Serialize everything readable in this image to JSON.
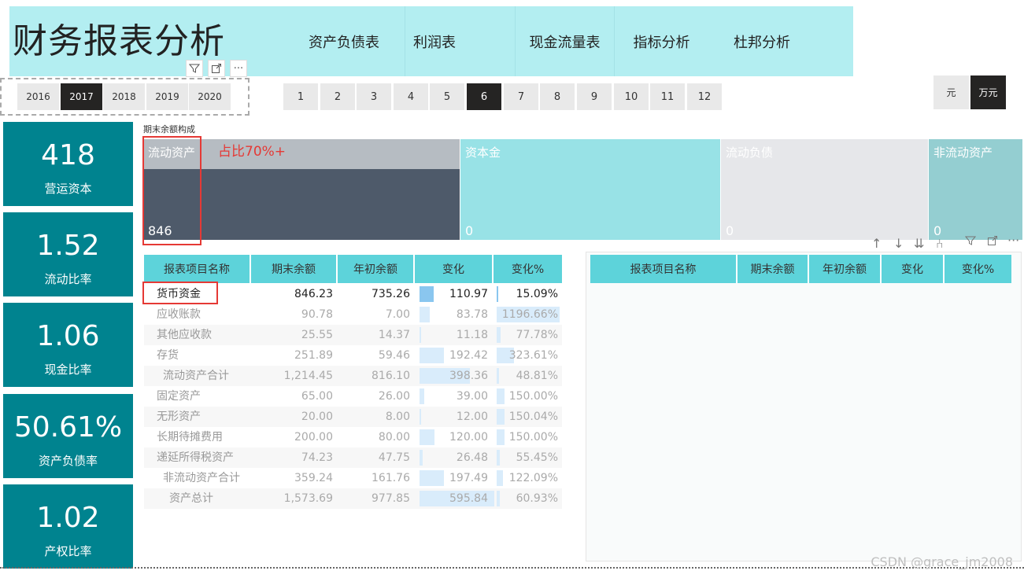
{
  "header": {
    "title": "财务报表分析",
    "nav": [
      "资产负债表",
      "利润表",
      "现金流量表",
      "指标分析",
      "杜邦分析"
    ]
  },
  "years": {
    "items": [
      "2016",
      "2017",
      "2018",
      "2019",
      "2020"
    ],
    "selected": "2017"
  },
  "months": {
    "items": [
      "1",
      "2",
      "3",
      "4",
      "5",
      "6",
      "7",
      "8",
      "9",
      "10",
      "11",
      "12"
    ],
    "selected": "6"
  },
  "units": {
    "items": [
      "元",
      "万元"
    ],
    "selected": "万元"
  },
  "kpis": [
    {
      "value": "418",
      "label": "营运资本"
    },
    {
      "value": "1.52",
      "label": "流动比率"
    },
    {
      "value": "1.06",
      "label": "现金比率"
    },
    {
      "value": "50.61%",
      "label": "资产负债率"
    },
    {
      "value": "1.02",
      "label": "产权比率"
    }
  ],
  "treemap": {
    "title": "期末余额构成",
    "annotation": "占比70%+",
    "tiles": [
      {
        "name": "流动资产",
        "value": "846",
        "fill": 0.7
      },
      {
        "name": "资本金",
        "value": "0"
      },
      {
        "name": "流动负债",
        "value": "0"
      },
      {
        "name": "非流动资产",
        "value": "0"
      }
    ]
  },
  "table": {
    "headers": [
      "报表项目名称",
      "期末余额",
      "年初余额",
      "变化",
      "变化%"
    ],
    "rows": [
      {
        "name": "货币资金",
        "end": "846.23",
        "begin": "735.26",
        "change": "110.97",
        "pct": "15.09%",
        "change_v": 110.97,
        "pct_v": 15.09,
        "highlight": true
      },
      {
        "name": "应收账款",
        "end": "90.78",
        "begin": "7.00",
        "change": "83.78",
        "pct": "1196.66%",
        "change_v": 83.78,
        "pct_v": 1196.66
      },
      {
        "name": "其他应收款",
        "end": "25.55",
        "begin": "14.37",
        "change": "11.18",
        "pct": "77.78%",
        "change_v": 11.18,
        "pct_v": 77.78
      },
      {
        "name": "存货",
        "end": "251.89",
        "begin": "59.46",
        "change": "192.42",
        "pct": "323.61%",
        "change_v": 192.42,
        "pct_v": 323.61
      },
      {
        "name": "流动资产合计",
        "end": "1,214.45",
        "begin": "816.10",
        "change": "398.36",
        "pct": "48.81%",
        "change_v": 398.36,
        "pct_v": 48.81,
        "indent": 1
      },
      {
        "name": "固定资产",
        "end": "65.00",
        "begin": "26.00",
        "change": "39.00",
        "pct": "150.00%",
        "change_v": 39.0,
        "pct_v": 150.0
      },
      {
        "name": "无形资产",
        "end": "20.00",
        "begin": "8.00",
        "change": "12.00",
        "pct": "150.04%",
        "change_v": 12.0,
        "pct_v": 150.04
      },
      {
        "name": "长期待摊费用",
        "end": "200.00",
        "begin": "80.00",
        "change": "120.00",
        "pct": "150.00%",
        "change_v": 120.0,
        "pct_v": 150.0
      },
      {
        "name": "递延所得税资产",
        "end": "74.23",
        "begin": "47.75",
        "change": "26.48",
        "pct": "55.45%",
        "change_v": 26.48,
        "pct_v": 55.45
      },
      {
        "name": "非流动资产合计",
        "end": "359.24",
        "begin": "161.76",
        "change": "197.49",
        "pct": "122.09%",
        "change_v": 197.49,
        "pct_v": 122.09,
        "indent": 1
      },
      {
        "name": "资产总计",
        "end": "1,573.69",
        "begin": "977.85",
        "change": "595.84",
        "pct": "60.93%",
        "change_v": 595.84,
        "pct_v": 60.93,
        "indent": 2
      }
    ]
  },
  "right_table": {
    "headers": [
      "报表项目名称",
      "期末余额",
      "年初余额",
      "变化",
      "变化%"
    ]
  },
  "watermark": "CSDN @grace_jm2008",
  "colors": {
    "header_bg": "#b3eef1",
    "kpi_bg": "#00838f",
    "selected": "#252423",
    "table_header": "#5dd3da",
    "annotation": "#e53935"
  }
}
